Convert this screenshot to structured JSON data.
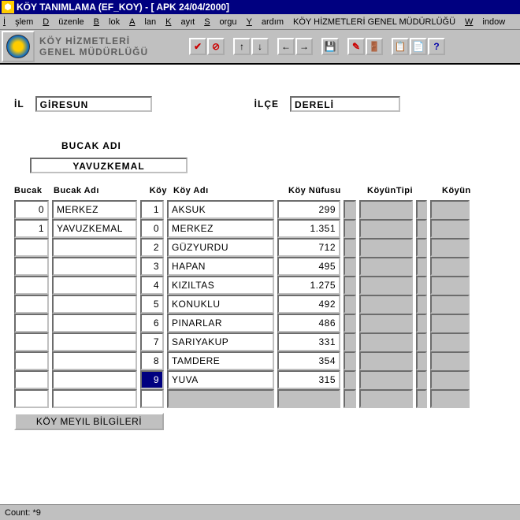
{
  "title": "KÖY TANIMLAMA (EF_KOY) - [    APK  24/04/2000]",
  "menu": {
    "islem": "İşlem",
    "duzenle": "Düzenle",
    "blok": "Blok",
    "alan": "Alan",
    "kayit": "Kayıt",
    "sorgu": "Sorgu",
    "yardim": "Yardım",
    "khgm": "KÖY HİZMETLERİ GENEL MÜDÜRLÜĞÜ",
    "window": "Window"
  },
  "org": {
    "line1": "KÖY HİZMETLERİ",
    "line2": "GENEL MÜDÜRLÜĞÜ"
  },
  "header": {
    "il_label": "İL",
    "il_value": "GİRESUN",
    "ilce_label": "İLÇE",
    "ilce_value": "DERELİ",
    "bucak_label": "BUCAK  ADI",
    "bucak_value": "YAVUZKEMAL"
  },
  "columns": {
    "bucak": "Bucak",
    "bucak_adi": "Bucak  Adı",
    "koy": "Köy",
    "koy_adi": "Köy  Adı",
    "koy_nufusu": "Köy  Nüfusu",
    "koyun_tipi": "KöyünTipi",
    "koyun": "Köyün"
  },
  "bucak_rows": [
    {
      "no": "0",
      "adi": "MERKEZ"
    },
    {
      "no": "1",
      "adi": "YAVUZKEMAL"
    }
  ],
  "koy_rows": [
    {
      "no": "1",
      "adi": "AKSUK",
      "nufus": "299"
    },
    {
      "no": "0",
      "adi": "MERKEZ",
      "nufus": "1.351"
    },
    {
      "no": "2",
      "adi": "GÜZYURDU",
      "nufus": "712"
    },
    {
      "no": "3",
      "adi": "HAPAN",
      "nufus": "495"
    },
    {
      "no": "4",
      "adi": "KIZILTAS",
      "nufus": "1.275"
    },
    {
      "no": "5",
      "adi": "KONUKLU",
      "nufus": "492"
    },
    {
      "no": "6",
      "adi": "PINARLAR",
      "nufus": "486"
    },
    {
      "no": "7",
      "adi": "SARIYAKUP",
      "nufus": "331"
    },
    {
      "no": "8",
      "adi": "TAMDERE",
      "nufus": "354"
    },
    {
      "no": "9",
      "adi": "YUVA",
      "nufus": "315"
    }
  ],
  "footer_button": "KÖY MEYIL BİLGİLERİ",
  "status": "Count: *9"
}
